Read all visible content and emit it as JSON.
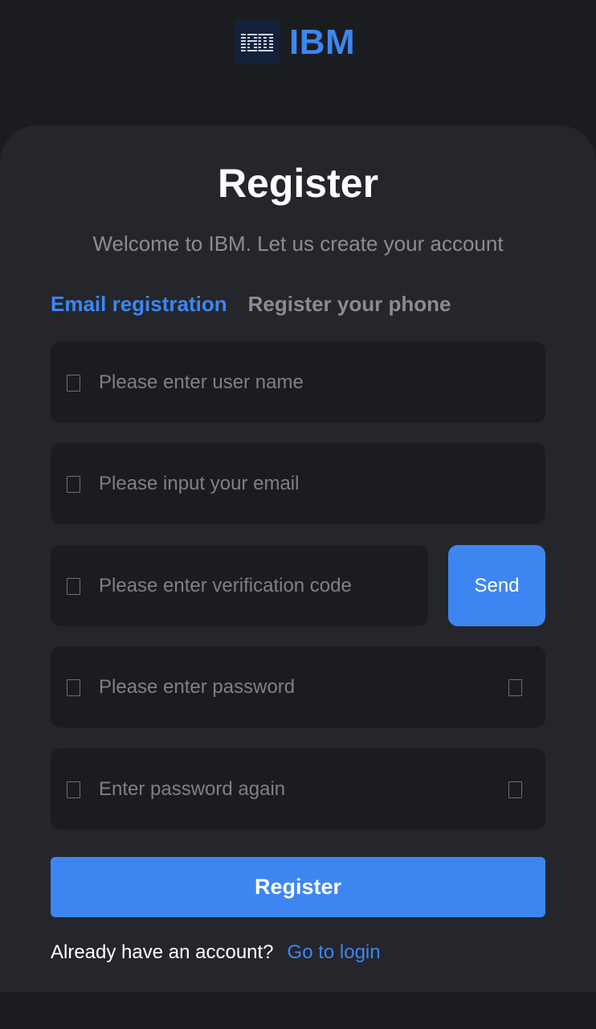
{
  "brand": {
    "name": "IBM",
    "accent": "#3d86f2",
    "logo_icon": "ibm-logo-icon",
    "logo_text": "IBM"
  },
  "form": {
    "title": "Register",
    "subtitle": "Welcome to IBM. Let us create your account",
    "tabs": [
      {
        "label": "Email registration",
        "active": true
      },
      {
        "label": "Register your phone",
        "active": false
      }
    ],
    "fields": {
      "username": {
        "placeholder": "Please enter user name",
        "value": "",
        "icon": "user-icon"
      },
      "email": {
        "placeholder": "Please input your email",
        "value": "",
        "icon": "mail-icon"
      },
      "code": {
        "placeholder": "Please enter verification code",
        "value": "",
        "icon": "shield-icon"
      },
      "password": {
        "placeholder": "Please enter password",
        "value": "",
        "icon": "lock-icon",
        "toggle_icon": "eye-icon"
      },
      "password_again": {
        "placeholder": "Enter password again",
        "value": "",
        "icon": "lock-icon",
        "toggle_icon": "eye-icon"
      }
    },
    "send_label": "Send",
    "register_label": "Register",
    "footer": {
      "question": "Already have an account?",
      "login_label": "Go to login"
    }
  },
  "colors": {
    "background": "#1b1c20",
    "card": "#24262b",
    "input_bg": "#1b1c20",
    "primary": "#3d86f2",
    "muted_text": "#8a8c91"
  }
}
